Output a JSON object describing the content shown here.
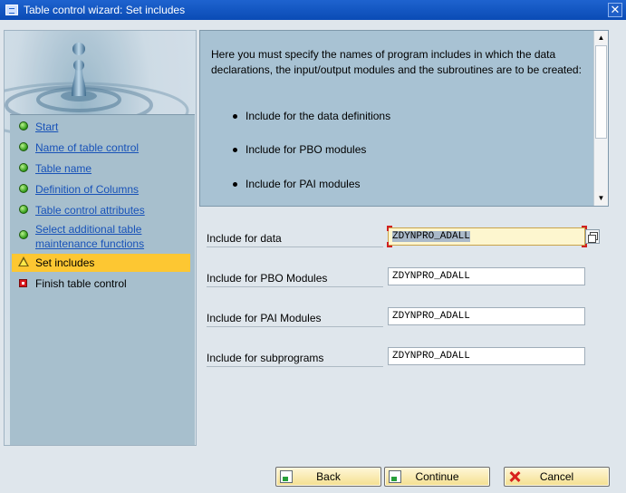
{
  "window": {
    "title": "Table control wizard: Set includes",
    "close_symbol": "✕"
  },
  "steps": [
    {
      "label": "Start",
      "state": "done",
      "icon": "green-light-icon"
    },
    {
      "label": "Name of table control",
      "state": "done",
      "icon": "green-light-icon"
    },
    {
      "label": "Table name",
      "state": "done",
      "icon": "green-light-icon"
    },
    {
      "label": "Definition of Columns",
      "state": "done",
      "icon": "green-light-icon"
    },
    {
      "label": "Table control attributes",
      "state": "done",
      "icon": "green-light-icon"
    },
    {
      "label": "Select additional table maintenance functions",
      "state": "done",
      "icon": "green-light-icon"
    },
    {
      "label": "Set includes",
      "state": "current",
      "icon": "warning-triangle-icon"
    },
    {
      "label": "Finish table control",
      "state": "pending",
      "icon": "red-square-icon"
    }
  ],
  "info": {
    "text": "Here you must specify the names of program includes in which the data declarations, the input/output modules and the subroutines are to be created:",
    "bullets": [
      "Include for the data definitions",
      "Include for PBO modules",
      "Include for PAI modules"
    ]
  },
  "form": {
    "data_label": "Include for data",
    "data_value": "ZDYNPRO_ADALL",
    "pbo_label": "Include for PBO Modules",
    "pbo_value": "ZDYNPRO_ADALL",
    "pai_label": "Include for PAI Modules",
    "pai_value": "ZDYNPRO_ADALL",
    "sub_label": "Include for subprograms",
    "sub_value": "ZDYNPRO_ADALL"
  },
  "buttons": {
    "back": "Back",
    "continue": "Continue",
    "cancel": "Cancel"
  },
  "colors": {
    "title_bar": "#0a4bb5",
    "current_step": "#fdc732",
    "info_panel": "#a8c2d3",
    "button": "#f4df8f"
  }
}
